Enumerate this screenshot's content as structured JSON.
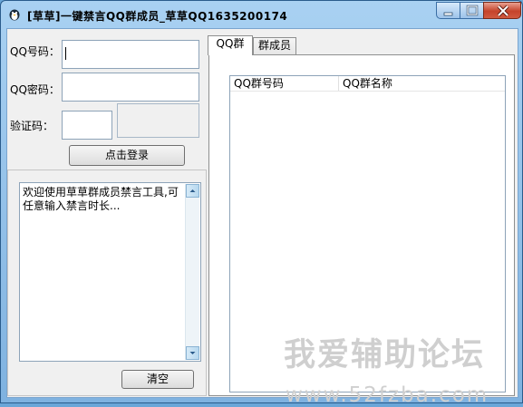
{
  "window": {
    "title": "[草草]一键禁言QQ群成员_草草QQ1635200174",
    "icon": "penguin-icon",
    "controls": [
      "minimize-icon",
      "maximize-icon",
      "close-icon"
    ]
  },
  "login": {
    "qq_label": "QQ号码：",
    "qq_value": "",
    "password_label": "QQ密码：",
    "password_value": "",
    "captcha_label": "验证码：",
    "captcha_value": "",
    "login_button": "点击登录"
  },
  "log": {
    "text": "欢迎使用草草群成员禁言工具,可任意输入禁言时长...",
    "clear_button": "清空"
  },
  "tabs": [
    {
      "label": "QQ群",
      "active": true
    },
    {
      "label": "群成员",
      "active": false
    }
  ],
  "group_list": {
    "columns": [
      "QQ群号码",
      "QQ群名称"
    ],
    "rows": []
  },
  "watermark": {
    "line1": "我爱辅助论坛",
    "line2": "www.52fzba.com"
  },
  "colors": {
    "titlebar": "#a9d1f2",
    "close_button": "#c5432b",
    "client_background": "#f0f0f0",
    "watermark": "#cfcfcf"
  }
}
